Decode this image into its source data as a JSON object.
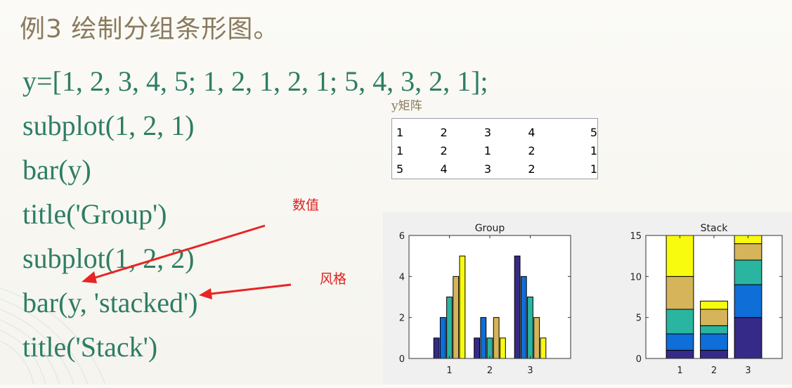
{
  "slide": {
    "title": "例3  绘制分组条形图。",
    "code_lines": [
      "y=[1, 2, 3, 4, 5; 1, 2, 1, 2, 1; 5, 4, 3, 2, 1];",
      "subplot(1, 2, 1)",
      "bar(y)",
      "title('Group')",
      "subplot(1, 2, 2)",
      "bar(y, 'stacked')",
      "title('Stack')"
    ],
    "matrix_label": "y矩阵",
    "matrix": [
      [
        "1",
        "2",
        "3",
        "4",
        "5"
      ],
      [
        "1",
        "2",
        "1",
        "2",
        "1"
      ],
      [
        "5",
        "4",
        "3",
        "2",
        "1"
      ]
    ],
    "annotations": {
      "values": "数值",
      "style": "风格"
    },
    "colors": {
      "code": "#2e7d66",
      "title": "#8a7a5e",
      "annotation": "#e02020"
    }
  },
  "chart_data": [
    {
      "type": "bar",
      "title": "Group",
      "categories": [
        "1",
        "2",
        "3"
      ],
      "series": [
        {
          "values": [
            1,
            1,
            5
          ],
          "color": "#352a87"
        },
        {
          "values": [
            2,
            2,
            4
          ],
          "color": "#0f6ed7"
        },
        {
          "values": [
            3,
            1,
            3
          ],
          "color": "#2ab5a0"
        },
        {
          "values": [
            4,
            2,
            2
          ],
          "color": "#d6b45a"
        },
        {
          "values": [
            5,
            1,
            1
          ],
          "color": "#f9fb0e"
        }
      ],
      "ylim": [
        0,
        6
      ],
      "yticks": [
        0,
        2,
        4,
        6
      ],
      "grid": false
    },
    {
      "type": "bar",
      "stacked": true,
      "title": "Stack",
      "categories": [
        "1",
        "2",
        "3"
      ],
      "series": [
        {
          "values": [
            1,
            1,
            5
          ],
          "color": "#352a87"
        },
        {
          "values": [
            2,
            2,
            4
          ],
          "color": "#0f6ed7"
        },
        {
          "values": [
            3,
            1,
            3
          ],
          "color": "#2ab5a0"
        },
        {
          "values": [
            4,
            2,
            2
          ],
          "color": "#d6b45a"
        },
        {
          "values": [
            5,
            1,
            1
          ],
          "color": "#f9fb0e"
        }
      ],
      "ylim": [
        0,
        15
      ],
      "yticks": [
        0,
        5,
        10,
        15
      ],
      "grid": false
    }
  ]
}
